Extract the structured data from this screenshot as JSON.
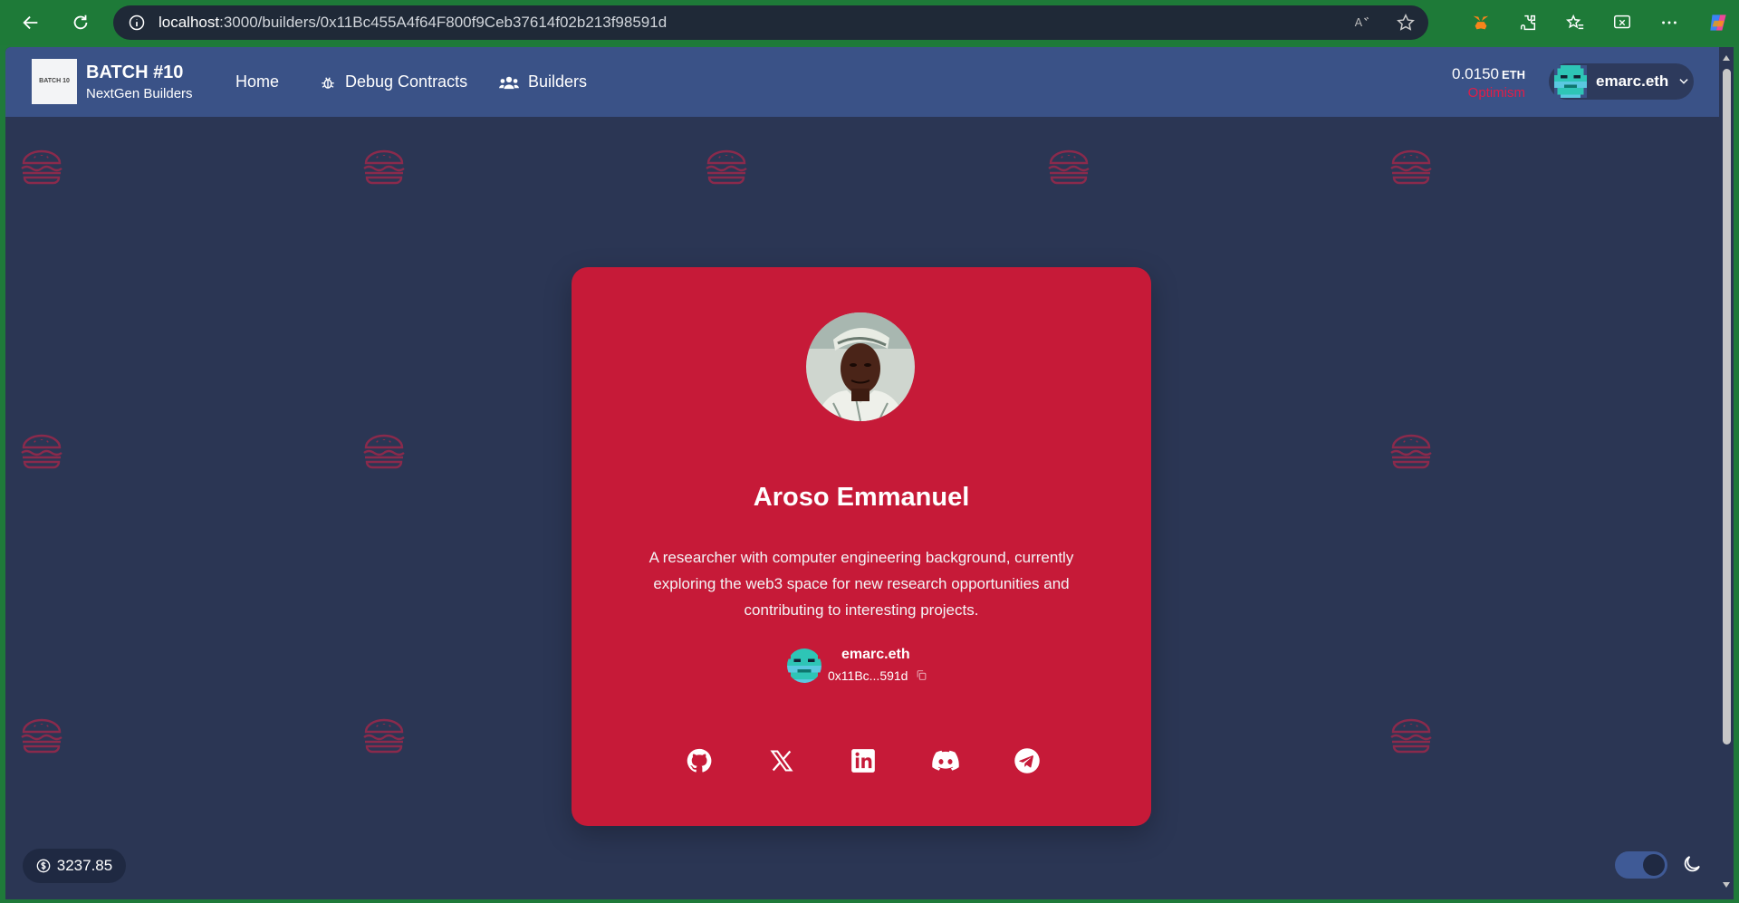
{
  "browser": {
    "url_host": "localhost",
    "url_path": ":3000/builders/0x11Bc455A4f64F800f9Ceb37614f02b213f98591d"
  },
  "header": {
    "logo_text": "BATCH 10",
    "brand_title": "BATCH #10",
    "brand_subtitle": "NextGen Builders",
    "nav": [
      {
        "label": "Home",
        "icon": ""
      },
      {
        "label": "Debug Contracts",
        "icon": "bug-icon"
      },
      {
        "label": "Builders",
        "icon": "users-icon"
      }
    ],
    "balance_amount": "0.0150",
    "balance_unit": "ETH",
    "network": "Optimism",
    "account_name": "emarc.eth"
  },
  "profile": {
    "name": "Aroso Emmanuel",
    "bio": "A researcher with computer engineering background, currently exploring the web3 space for new research opportunities and contributing to interesting projects.",
    "ens": "emarc.eth",
    "short_address": "0x11Bc...591d",
    "socials": [
      "github-icon",
      "x-icon",
      "linkedin-icon",
      "discord-icon",
      "telegram-icon"
    ]
  },
  "footer": {
    "eth_price": "3237.85"
  },
  "colors": {
    "background": "#2b3654",
    "header": "#3a5287",
    "card": "#c61a38",
    "network": "#e11d48"
  }
}
